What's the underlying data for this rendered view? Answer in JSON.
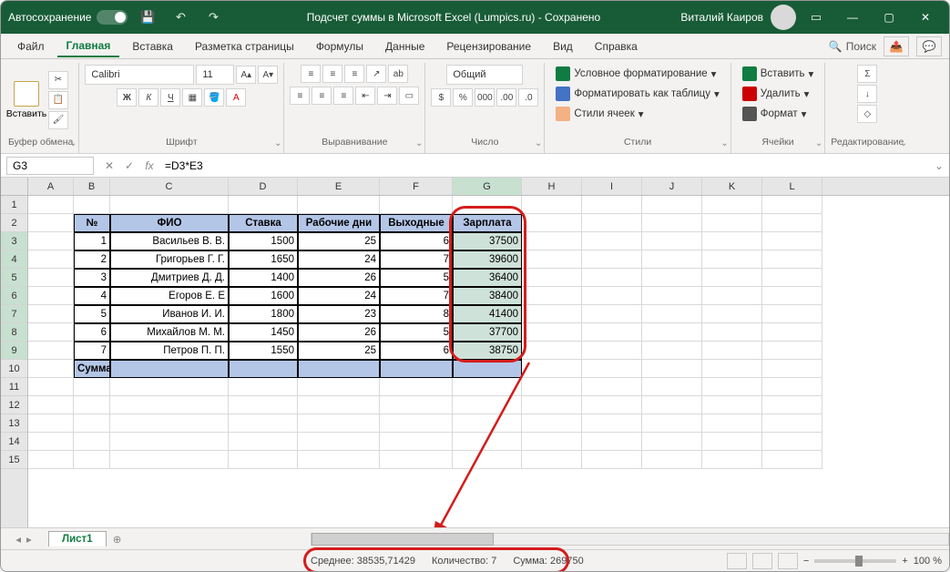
{
  "titlebar": {
    "autosave": "Автосохранение",
    "document_title": "Подсчет суммы в Microsoft Excel (Lumpics.ru)",
    "saved": " -  Сохранено",
    "user": "Виталий Каиров"
  },
  "tabs": {
    "file": "Файл",
    "home": "Главная",
    "insert": "Вставка",
    "layout": "Разметка страницы",
    "formulas": "Формулы",
    "data": "Данные",
    "review": "Рецензирование",
    "view": "Вид",
    "help": "Справка",
    "search_label": "Поиск"
  },
  "ribbon": {
    "clipboard": {
      "paste": "Вставить",
      "label": "Буфер обмена"
    },
    "font": {
      "name": "Calibri",
      "size": "11",
      "label": "Шрифт",
      "bold": "Ж",
      "italic": "К",
      "underline": "Ч"
    },
    "alignment": {
      "label": "Выравнивание"
    },
    "number": {
      "format": "Общий",
      "label": "Число"
    },
    "styles": {
      "cond": "Условное форматирование",
      "table": "Форматировать как таблицу",
      "cell": "Стили ячеек",
      "label": "Стили"
    },
    "cells": {
      "insert": "Вставить",
      "delete": "Удалить",
      "format": "Формат",
      "label": "Ячейки"
    },
    "editing": {
      "label": "Редактирование"
    }
  },
  "formula_bar": {
    "name_box": "G3",
    "fx": "fx",
    "value": "=D3*E3"
  },
  "columns": [
    "A",
    "B",
    "C",
    "D",
    "E",
    "F",
    "G",
    "H",
    "I",
    "J",
    "K",
    "L"
  ],
  "rows_visible": 14,
  "table": {
    "headers": {
      "num": "№",
      "fio": "ФИО",
      "rate": "Ставка",
      "days": "Рабочие дни",
      "weekend": "Выходные",
      "salary": "Зарплата"
    },
    "rows": [
      {
        "n": "1",
        "fio": "Васильев В. В.",
        "rate": "1500",
        "days": "25",
        "weekend": "6",
        "salary": "37500"
      },
      {
        "n": "2",
        "fio": "Григорьев Г. Г.",
        "rate": "1650",
        "days": "24",
        "weekend": "7",
        "salary": "39600"
      },
      {
        "n": "3",
        "fio": "Дмитриев Д. Д.",
        "rate": "1400",
        "days": "26",
        "weekend": "5",
        "salary": "36400"
      },
      {
        "n": "4",
        "fio": "Егоров Е. Е",
        "rate": "1600",
        "days": "24",
        "weekend": "7",
        "salary": "38400"
      },
      {
        "n": "5",
        "fio": "Иванов И. И.",
        "rate": "1800",
        "days": "23",
        "weekend": "8",
        "salary": "41400"
      },
      {
        "n": "6",
        "fio": "Михайлов М. М.",
        "rate": "1450",
        "days": "26",
        "weekend": "5",
        "salary": "37700"
      },
      {
        "n": "7",
        "fio": "Петров П. П.",
        "rate": "1550",
        "days": "25",
        "weekend": "6",
        "salary": "38750"
      }
    ],
    "sum_label": "Сумма"
  },
  "sheets": {
    "sheet1": "Лист1"
  },
  "statusbar": {
    "avg": "Среднее: 38535,71429",
    "count": "Количество: 7",
    "sum": "Сумма: 269750",
    "zoom": "100 %"
  }
}
